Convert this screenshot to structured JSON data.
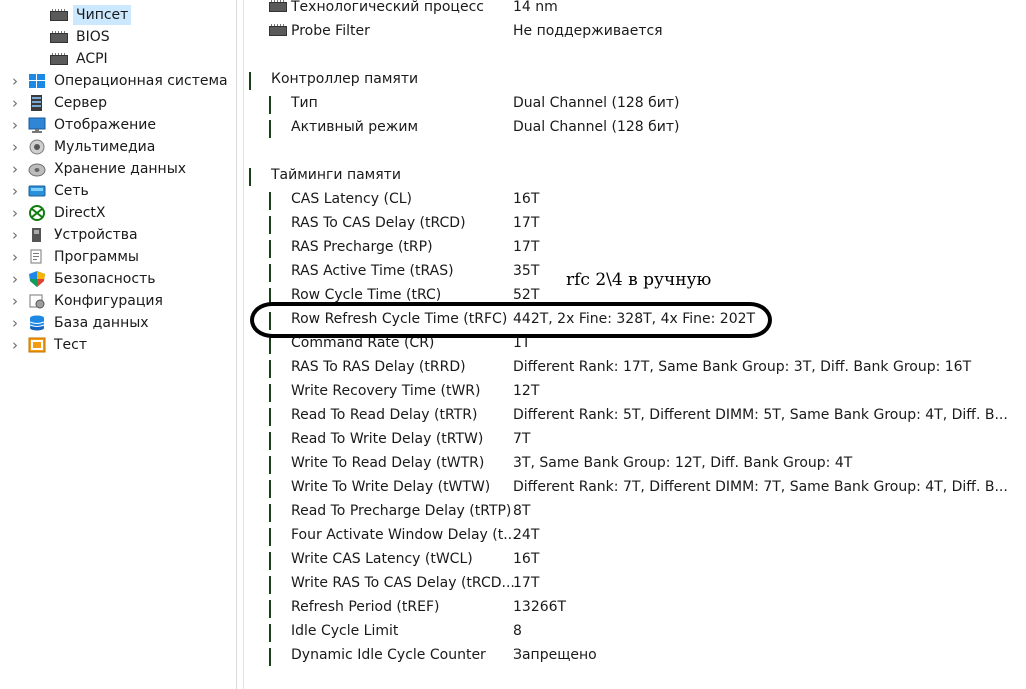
{
  "tree": {
    "items": [
      {
        "label": "Чипсет",
        "icon": "chip-icon",
        "expandable": false,
        "selected": true,
        "level": 2
      },
      {
        "label": "BIOS",
        "icon": "chip-icon",
        "expandable": false,
        "selected": false,
        "level": 2
      },
      {
        "label": "ACPI",
        "icon": "chip-icon",
        "expandable": false,
        "selected": false,
        "level": 2
      },
      {
        "label": "Операционная система",
        "icon": "windows-icon",
        "expandable": true,
        "level": 1
      },
      {
        "label": "Сервер",
        "icon": "server-icon",
        "expandable": true,
        "level": 1
      },
      {
        "label": "Отображение",
        "icon": "monitor-icon",
        "expandable": true,
        "level": 1
      },
      {
        "label": "Мультимедиа",
        "icon": "speaker-icon",
        "expandable": true,
        "level": 1
      },
      {
        "label": "Хранение данных",
        "icon": "disk-icon",
        "expandable": true,
        "level": 1
      },
      {
        "label": "Сеть",
        "icon": "network-icon",
        "expandable": true,
        "level": 1
      },
      {
        "label": "DirectX",
        "icon": "xbox-icon",
        "expandable": true,
        "level": 1
      },
      {
        "label": "Устройства",
        "icon": "device-icon",
        "expandable": true,
        "level": 1
      },
      {
        "label": "Программы",
        "icon": "programs-icon",
        "expandable": true,
        "level": 1
      },
      {
        "label": "Безопасность",
        "icon": "shield-icon",
        "expandable": true,
        "level": 1
      },
      {
        "label": "Конфигурация",
        "icon": "config-icon",
        "expandable": true,
        "level": 1
      },
      {
        "label": "База данных",
        "icon": "database-icon",
        "expandable": true,
        "level": 1
      },
      {
        "label": "Тест",
        "icon": "test-icon",
        "expandable": true,
        "level": 1
      }
    ]
  },
  "details": {
    "rows": [
      {
        "type": "item",
        "icon": "chip-icon",
        "name": "Технологический процесс",
        "value": "14 nm"
      },
      {
        "type": "item",
        "icon": "chip-icon",
        "name": "Probe Filter",
        "value": "Не поддерживается"
      },
      {
        "type": "group",
        "icon": "ram-icon",
        "name": "Контроллер памяти"
      },
      {
        "type": "item",
        "icon": "ram-icon",
        "name": "Тип",
        "value": "Dual Channel  (128 бит)"
      },
      {
        "type": "item",
        "icon": "ram-icon",
        "name": "Активный режим",
        "value": "Dual Channel  (128 бит)"
      },
      {
        "type": "group",
        "icon": "ram-icon",
        "name": "Тайминги памяти"
      },
      {
        "type": "item",
        "icon": "ram-icon",
        "name": "CAS Latency (CL)",
        "value": "16T"
      },
      {
        "type": "item",
        "icon": "ram-icon",
        "name": "RAS To CAS Delay (tRCD)",
        "value": "17T"
      },
      {
        "type": "item",
        "icon": "ram-icon",
        "name": "RAS Precharge (tRP)",
        "value": "17T"
      },
      {
        "type": "item",
        "icon": "ram-icon",
        "name": "RAS Active Time (tRAS)",
        "value": "35T"
      },
      {
        "type": "item",
        "icon": "ram-icon",
        "name": "Row Cycle Time (tRC)",
        "value": "52T"
      },
      {
        "type": "item",
        "icon": "ram-icon",
        "name": "Row Refresh Cycle Time (tRFC)",
        "value": "442T, 2x Fine: 328T, 4x Fine: 202T"
      },
      {
        "type": "item",
        "icon": "ram-icon",
        "name": "Command Rate (CR)",
        "value": "1T"
      },
      {
        "type": "item",
        "icon": "ram-icon",
        "name": "RAS To RAS Delay (tRRD)",
        "value": "Different Rank: 17T, Same Bank Group: 3T, Diff. Bank Group: 16T"
      },
      {
        "type": "item",
        "icon": "ram-icon",
        "name": "Write Recovery Time (tWR)",
        "value": "12T"
      },
      {
        "type": "item",
        "icon": "ram-icon",
        "name": "Read To Read Delay (tRTR)",
        "value": "Different Rank: 5T, Different DIMM: 5T, Same Bank Group: 4T, Diff. B..."
      },
      {
        "type": "item",
        "icon": "ram-icon",
        "name": "Read To Write Delay (tRTW)",
        "value": "7T"
      },
      {
        "type": "item",
        "icon": "ram-icon",
        "name": "Write To Read Delay (tWTR)",
        "value": "3T, Same Bank Group: 12T, Diff. Bank Group: 4T"
      },
      {
        "type": "item",
        "icon": "ram-icon",
        "name": "Write To Write Delay (tWTW)",
        "value": "Different Rank: 7T, Different DIMM: 7T, Same Bank Group: 4T, Diff. B..."
      },
      {
        "type": "item",
        "icon": "ram-icon",
        "name": "Read To Precharge Delay (tRTP)",
        "value": "8T"
      },
      {
        "type": "item",
        "icon": "ram-icon",
        "name": "Four Activate Window Delay (t...",
        "value": "24T"
      },
      {
        "type": "item",
        "icon": "ram-icon",
        "name": "Write CAS Latency (tWCL)",
        "value": "16T"
      },
      {
        "type": "item",
        "icon": "ram-icon",
        "name": "Write RAS To CAS Delay (tRCD...",
        "value": "17T"
      },
      {
        "type": "item",
        "icon": "ram-icon",
        "name": "Refresh Period (tREF)",
        "value": "13266T"
      },
      {
        "type": "item",
        "icon": "ram-icon",
        "name": "Idle Cycle Limit",
        "value": "8"
      },
      {
        "type": "item",
        "icon": "ram-icon",
        "name": "Dynamic Idle Cycle Counter",
        "value": "Запрещено"
      }
    ]
  },
  "annotation": {
    "text": "rfc 2\\4 в ручную",
    "highlighted_row": "Row Refresh Cycle Time (tRFC)"
  },
  "colors": {
    "selection": "#cce8ff",
    "annotation": "#000000"
  }
}
